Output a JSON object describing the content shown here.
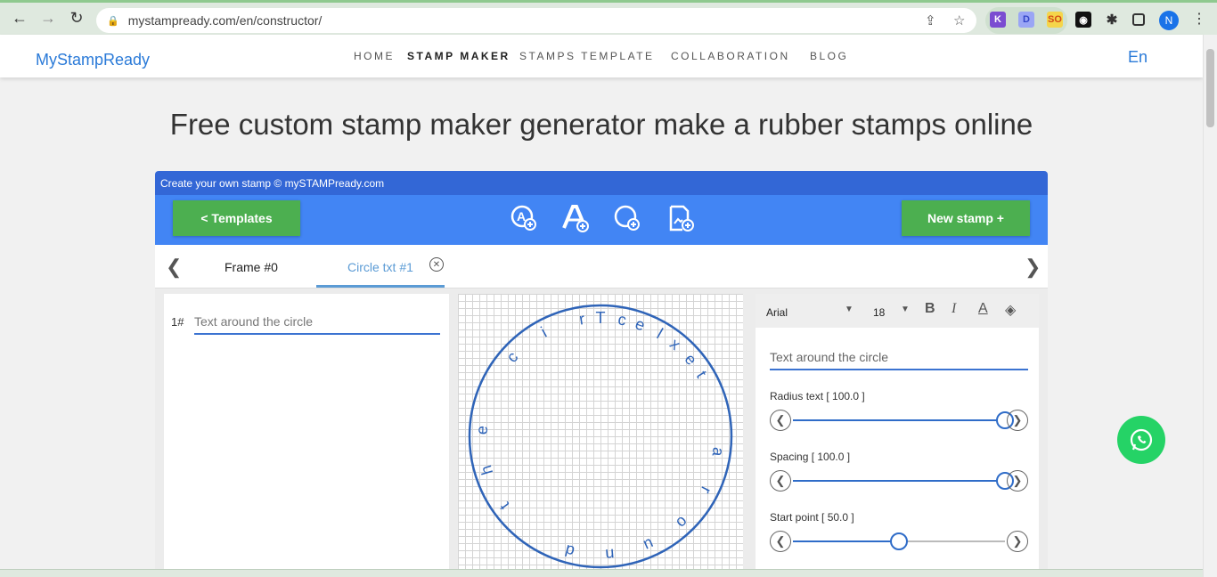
{
  "browser": {
    "url": "mystampready.com/en/constructor/",
    "profile_initial": "N"
  },
  "site": {
    "logo": "MyStampReady",
    "nav": [
      "HOME",
      "STAMP MAKER",
      "STAMPS TEMPLATE",
      "COLLABORATION",
      "BLOG"
    ],
    "lang": "En"
  },
  "page": {
    "title": "Free custom stamp maker generator make a rubber stamps online"
  },
  "constructor": {
    "caption": "Create your own stamp © mySTAMPready.com",
    "templates_label": "<  Templates",
    "new_stamp_label": "New stamp +",
    "tabs": [
      "Frame #0",
      "Circle txt #1"
    ],
    "row_number": "1#",
    "row_text": "Text around the circle",
    "stamp_text": "Text around the circle"
  },
  "properties": {
    "font": "Arial",
    "size": "18",
    "text_value": "Text around the circle",
    "radius_label": "Radius text [ 100.0 ]",
    "radius_value": 100,
    "spacing_label": "Spacing [ 100.0 ]",
    "spacing_value": 100,
    "start_label": "Start point [ 50.0 ]",
    "start_value": 50
  },
  "colors": {
    "accent_blue": "#4285f4",
    "dark_blue": "#3367d6",
    "green": "#4caf50",
    "stamp": "#2f64b8",
    "whatsapp": "#25d366"
  }
}
